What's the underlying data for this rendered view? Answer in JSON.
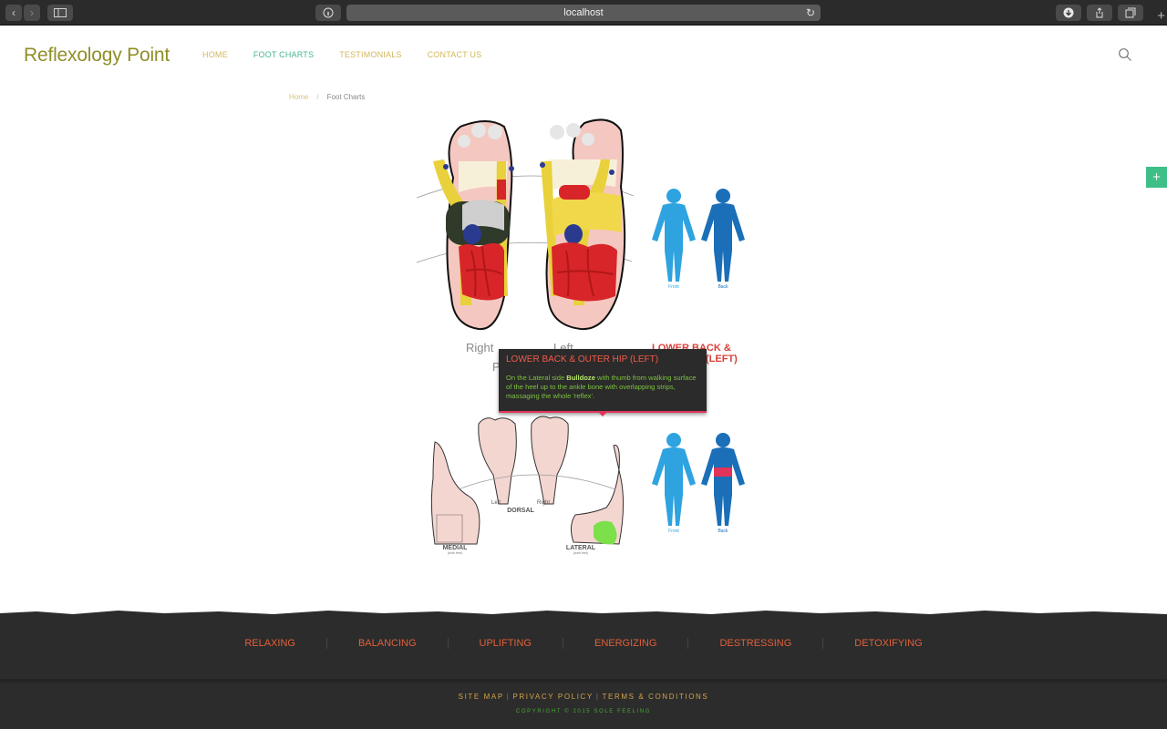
{
  "browser": {
    "url": "localhost",
    "nav_back": "‹",
    "nav_fwd": "›"
  },
  "site": {
    "logo": "Reflexology Point",
    "nav": [
      {
        "label": "HOME"
      },
      {
        "label": "FOOT CHARTS"
      },
      {
        "label": "TESTIMONIALS"
      },
      {
        "label": "CONTACT US"
      }
    ]
  },
  "breadcrumb": {
    "home": "Home",
    "separator": "/",
    "current": "Foot Charts"
  },
  "chart_labels": {
    "sole_right": "Right",
    "sole_left": "Left",
    "sole_p": "P",
    "figure_front": "Front",
    "figure_back": "Back",
    "area_title_line1": "LOWER BACK &",
    "area_title_line2": "(LEFT)",
    "dorsal_left": "Left",
    "dorsal_right": "Right",
    "dorsal": "DORSAL",
    "medial": "MEDIAL",
    "medial_sub": "(both feet)",
    "lateral": "LATERAL",
    "lateral_sub": "(both feet)"
  },
  "tooltip": {
    "title": "LOWER BACK & OUTER HIP (LEFT)",
    "body_before": "On the Lateral side ",
    "body_bold": "Bulldoze",
    "body_after": " with thumb from walking surface of the heel up to the ankle bone with overlapping strips, massaging the whole 'reflex'."
  },
  "footer": {
    "categories": [
      "RELAXING",
      "BALANCING",
      "UPLIFTING",
      "ENERGIZING",
      "DESTRESSING",
      "DETOXIFYING"
    ],
    "links": [
      "SITE MAP",
      "PRIVACY POLICY",
      "TERMS & CONDITIONS"
    ],
    "link_separator": "|",
    "copyright": "COPYRIGHT © 2015 SOLE FEELING"
  },
  "colors": {
    "logo": "#8f8f2a",
    "nav": "#d1b85b",
    "nav_active": "#47b58f",
    "footer_category": "#e0603a",
    "tooltip_title": "#f25a4a",
    "tooltip_body": "#7cc23f",
    "body_front": "#2ea3e0",
    "body_back": "#1a6fb8",
    "highlight_zone": "#e0345a"
  },
  "icons": {
    "search": "search-icon",
    "side_button": "plus-icon"
  }
}
